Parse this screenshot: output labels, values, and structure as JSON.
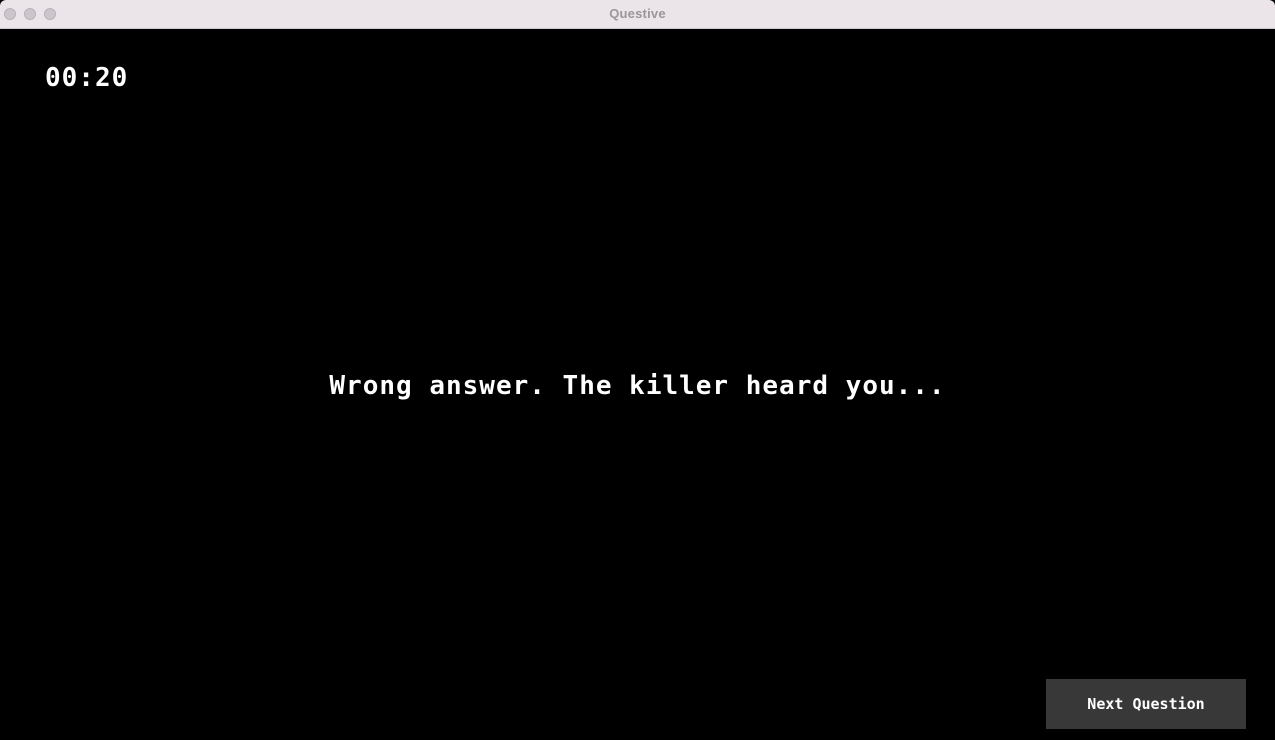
{
  "window": {
    "title": "Questive"
  },
  "game": {
    "timer": "00:20",
    "message": "Wrong answer. The killer heard you...",
    "next_button_label": "Next Question"
  },
  "colors": {
    "background": "#000000",
    "text": "#ffffff",
    "button_bg": "#383838",
    "titlebar_bg": "#ebe5ea"
  }
}
